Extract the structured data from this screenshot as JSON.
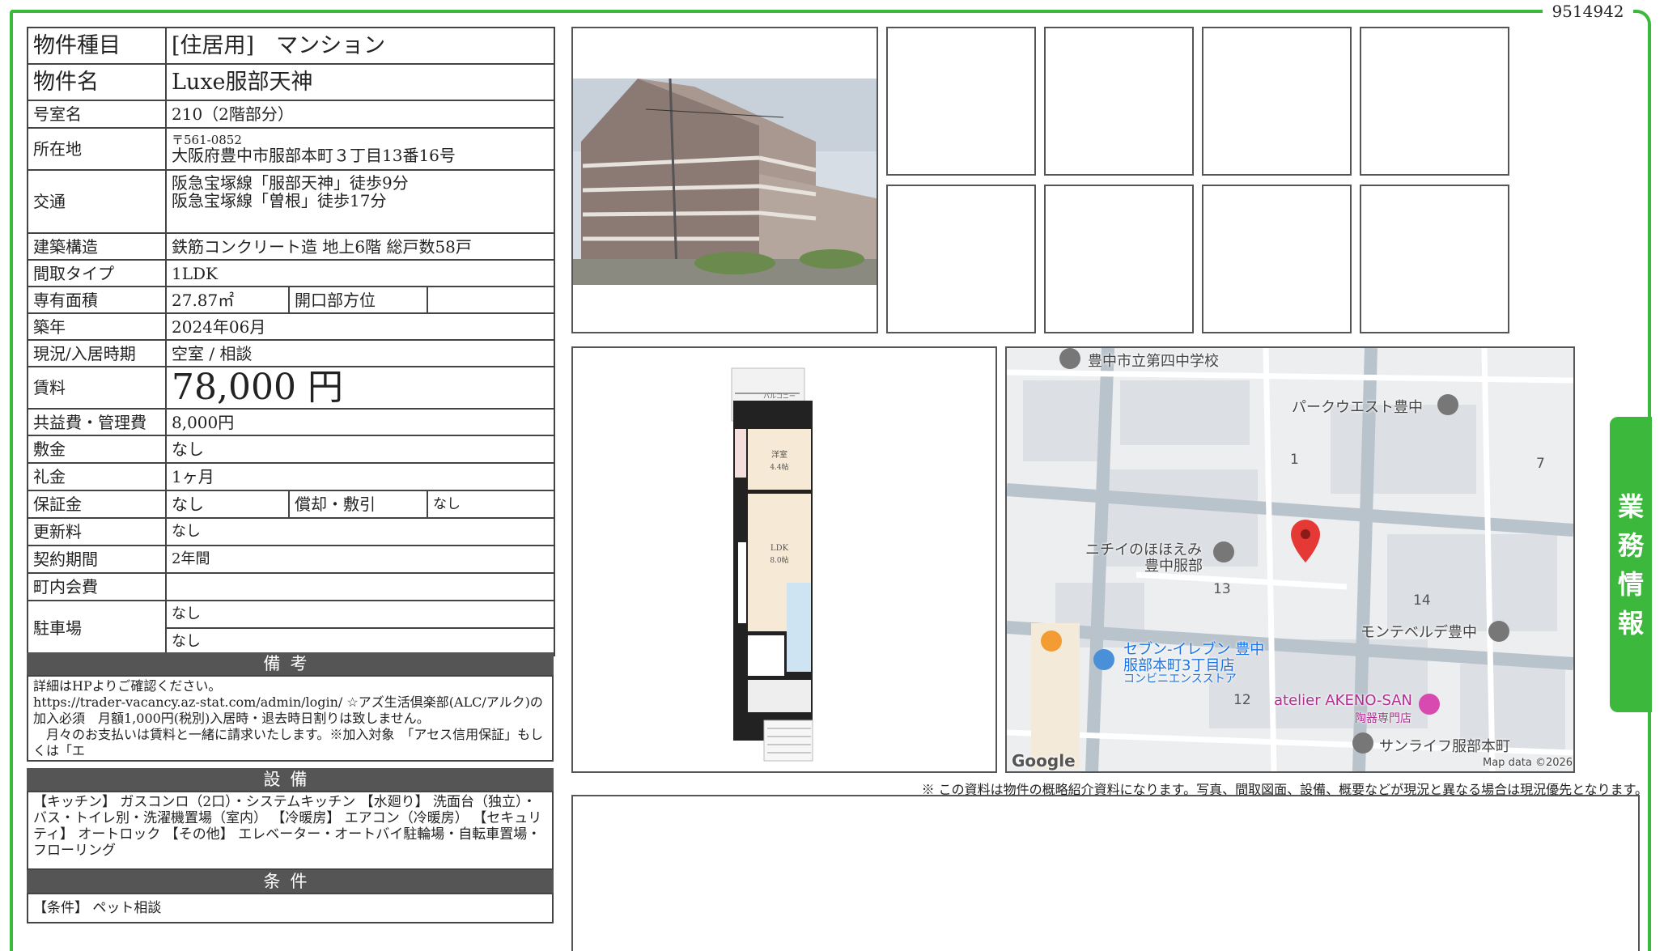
{
  "property_id": "9514942",
  "side_tab": {
    "label": "業務情報",
    "chars": [
      "業",
      "務",
      "情",
      "報"
    ]
  },
  "fields": {
    "type_label": "物件種目",
    "type_value": "[住居用]　マンション",
    "name_label": "物件名",
    "name_value": "Luxe服部天神",
    "room_label": "号室名",
    "room_value": "210（2階部分）",
    "address_label": "所在地",
    "postal": "〒561-0852",
    "address_value": "大阪府豊中市服部本町３丁目13番16号",
    "transit_label": "交通",
    "transit_1": "阪急宝塚線「服部天神」徒歩9分",
    "transit_2": "阪急宝塚線「曽根」徒歩17分",
    "structure_label": "建築構造",
    "structure_value": "鉄筋コンクリート造 地上6階 総戸数58戸",
    "layout_label": "間取タイプ",
    "layout_value": "1LDK",
    "area_label": "専有面積",
    "area_value": "27.87㎡",
    "opening_label": "開口部方位",
    "opening_value": "",
    "built_label": "築年",
    "built_value": "2024年06月",
    "status_label": "現況/入居時期",
    "status_value": "空室 / 相談",
    "rent_label": "賃料",
    "rent_value": "78,000 円",
    "fee_label": "共益費・管理費",
    "fee_value": "8,000円",
    "deposit_label": "敷金",
    "deposit_value": "なし",
    "key_money_label": "礼金",
    "key_money_value": "1ヶ月",
    "guarantee_label": "保証金",
    "guarantee_value": "なし",
    "amort_label": "償却・敷引",
    "amort_value": "なし",
    "renewal_label": "更新料",
    "renewal_value": "なし",
    "contract_label": "契約期間",
    "contract_value": "2年間",
    "assoc_label": "町内会費",
    "assoc_value": "",
    "parking_label": "駐車場",
    "parking_1": "なし",
    "parking_2": "なし"
  },
  "remarks": {
    "title": "備考",
    "text": "詳細はHPよりご確認ください。\nhttps://trader-vacancy.az-stat.com/admin/login/ ☆アズ生活倶楽部(ALC/アルク)の加入必須　月額1,000円(税別)入居時・退去時日割りは致しません。\n　月々のお支払いは賃料と一緒に請求いたします。※加入対象　「アセス信用保証」もしくは「エ"
  },
  "equipment": {
    "title": "設備",
    "text": "【キッチン】 ガスコンロ（2口）・システムキッチン 【水廻り】 洗面台（独立）・バス・トイレ別・洗濯機置場（室内） 【冷暖房】 エアコン（冷暖房） 【セキュリティ】 オートロック 【その他】 エレベーター・オートバイ駐輪場・自転車置場・フローリング"
  },
  "conditions": {
    "title": "条件",
    "text": "【条件】 ペット相談"
  },
  "map": {
    "labels": {
      "school": "豊中市立第四中学校",
      "park_west": "パークウエスト豊中",
      "nichii_1": "ニチイのほほえみ",
      "nichii_2": "豊中服部",
      "seven_1": "セブン-イレブン 豊中",
      "seven_2": "服部本町3丁目店",
      "seven_3": "コンビニエンスストア",
      "montebelde": "モンテベルデ豊中",
      "akeno": "atelier AKENO-SAN",
      "akeno_sub": "陶器専門店",
      "sunlife": "サンライフ服部本町",
      "google": "Google",
      "map_data": "Map data ©2026"
    },
    "numbers": [
      "1",
      "7",
      "13",
      "14",
      "12"
    ],
    "pin_color": "#e53935"
  },
  "floorplan": {
    "room_label": "洋室",
    "room_size": "4.4帖",
    "ldk_label": "LDK",
    "ldk_size": "8.0帖",
    "balcony": "バルコニー"
  },
  "disclaimer": "※ この資料は物件の概略紹介資料になります。写真、間取図面、設備、概要などが現況と異なる場合は現況優先となります。",
  "colors": {
    "accent": "#3cb83c",
    "section_bar": "#555555"
  }
}
